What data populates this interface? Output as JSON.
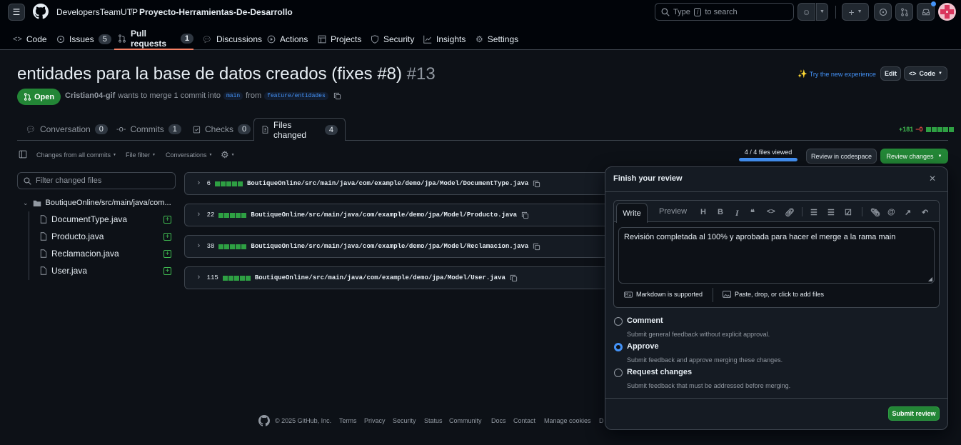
{
  "header": {
    "owner": "DevelopersTeamUTP",
    "separator": "/",
    "repo": "Proyecto-Herramientas-De-Desarrollo",
    "search_type": "Type",
    "search_key": "/",
    "search_suffix": "to search"
  },
  "repo_nav": [
    {
      "label": "Code",
      "count": ""
    },
    {
      "label": "Issues",
      "count": "5"
    },
    {
      "label": "Pull requests",
      "count": "1"
    },
    {
      "label": "Discussions",
      "count": ""
    },
    {
      "label": "Actions",
      "count": ""
    },
    {
      "label": "Projects",
      "count": ""
    },
    {
      "label": "Security",
      "count": ""
    },
    {
      "label": "Insights",
      "count": ""
    },
    {
      "label": "Settings",
      "count": ""
    }
  ],
  "pr": {
    "title": "entidades para la base de datos creados (fixes #8)",
    "number": "#13",
    "try_label": "Try the new experience",
    "edit_label": "Edit",
    "code_label": "Code",
    "state": "Open",
    "author": "Cristian04-gif",
    "meta_text": "wants to merge 1 commit into",
    "base": "main",
    "from_text": "from",
    "head": "feature/entidades"
  },
  "pr_tabs": [
    {
      "label": "Conversation",
      "count": "0"
    },
    {
      "label": "Commits",
      "count": "1"
    },
    {
      "label": "Checks",
      "count": "0"
    },
    {
      "label": "Files changed",
      "count": "4"
    }
  ],
  "diffstat": {
    "additions": "+181",
    "deletions": "−0"
  },
  "toolbar": {
    "changes_from": "Changes from all commits",
    "file_filter": "File filter",
    "conversations": "Conversations",
    "files_viewed": "4 / 4 files viewed",
    "files_viewed_fraction": 1.0,
    "codespace": "Review in codespace",
    "review_changes": "Review changes"
  },
  "tree": {
    "filter_placeholder": "Filter changed files",
    "folder": "BoutiqueOnline/src/main/java/com...",
    "files": [
      "DocumentType.java",
      "Producto.java",
      "Reclamacion.java",
      "User.java"
    ]
  },
  "diff_files": [
    {
      "count": "6",
      "path": "BoutiqueOnline/src/main/java/com/example/demo/jpa/Model/DocumentType.java"
    },
    {
      "count": "22",
      "path": "BoutiqueOnline/src/main/java/com/example/demo/jpa/Model/Producto.java"
    },
    {
      "count": "38",
      "path": "BoutiqueOnline/src/main/java/com/example/demo/jpa/Model/Reclamacion.java"
    },
    {
      "count": "115",
      "path": "BoutiqueOnline/src/main/java/com/example/demo/jpa/Model/User.java"
    }
  ],
  "review": {
    "title": "Finish your review",
    "write_tab": "Write",
    "preview_tab": "Preview",
    "comment_text": "Revisión completada al 100% y aprobada para hacer el merge a la rama main",
    "markdown_note": "Markdown is supported",
    "attach_note": "Paste, drop, or click to add files",
    "options": [
      {
        "title": "Comment",
        "desc": "Submit general feedback without explicit approval.",
        "checked": false
      },
      {
        "title": "Approve",
        "desc": "Submit feedback and approve merging these changes.",
        "checked": true
      },
      {
        "title": "Request changes",
        "desc": "Submit feedback that must be addressed before merging.",
        "checked": false
      }
    ],
    "submit_label": "Submit review"
  },
  "footer": {
    "copyright": "© 2025 GitHub, Inc.",
    "links": [
      "Terms",
      "Privacy",
      "Security",
      "Status",
      "Community",
      "Docs",
      "Contact",
      "Manage cookies",
      "D"
    ]
  },
  "colors": {
    "accent_green": "#238636",
    "link_blue": "#4493f8",
    "nav_underline": "#f78166"
  }
}
